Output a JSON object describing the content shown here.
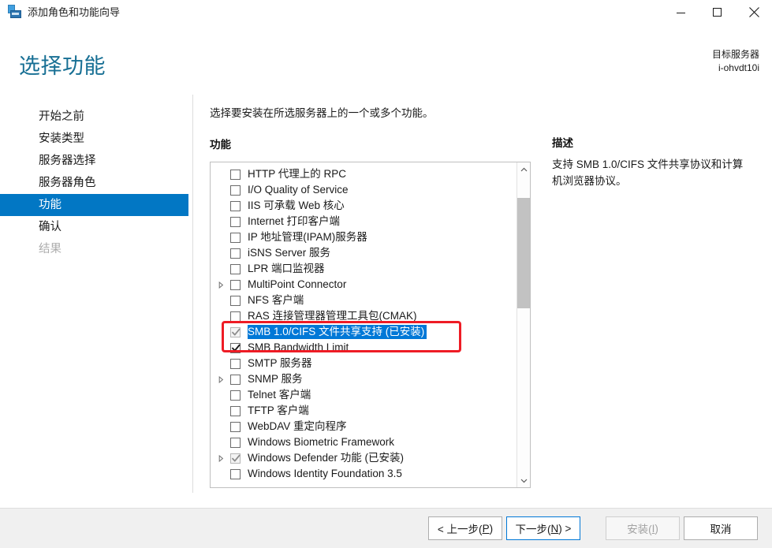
{
  "window": {
    "title": "添加角色和功能向导",
    "icon": "server-wizard-icon",
    "buttons": {
      "minimize": "minimize-icon",
      "maximize": "maximize-icon",
      "close": "close-icon"
    }
  },
  "header": {
    "page_title": "选择功能",
    "target_server_label": "目标服务器",
    "target_server_name": "i-ohvdt10i"
  },
  "sidebar": {
    "items": [
      {
        "label": "开始之前",
        "state": "normal"
      },
      {
        "label": "安装类型",
        "state": "normal"
      },
      {
        "label": "服务器选择",
        "state": "normal"
      },
      {
        "label": "服务器角色",
        "state": "normal"
      },
      {
        "label": "功能",
        "state": "selected"
      },
      {
        "label": "确认",
        "state": "normal"
      },
      {
        "label": "结果",
        "state": "disabled"
      }
    ]
  },
  "main": {
    "instruction": "选择要安装在所选服务器上的一个或多个功能。",
    "features_label": "功能",
    "features": [
      {
        "label": "HTTP 代理上的 RPC",
        "checked": false,
        "disabled": false,
        "expandable": false,
        "selected": false
      },
      {
        "label": "I/O Quality of Service",
        "checked": false,
        "disabled": false,
        "expandable": false,
        "selected": false
      },
      {
        "label": "IIS 可承载 Web 核心",
        "checked": false,
        "disabled": false,
        "expandable": false,
        "selected": false
      },
      {
        "label": "Internet 打印客户端",
        "checked": false,
        "disabled": false,
        "expandable": false,
        "selected": false
      },
      {
        "label": "IP 地址管理(IPAM)服务器",
        "checked": false,
        "disabled": false,
        "expandable": false,
        "selected": false
      },
      {
        "label": "iSNS Server 服务",
        "checked": false,
        "disabled": false,
        "expandable": false,
        "selected": false
      },
      {
        "label": "LPR 端口监视器",
        "checked": false,
        "disabled": false,
        "expandable": false,
        "selected": false
      },
      {
        "label": "MultiPoint Connector",
        "checked": false,
        "disabled": false,
        "expandable": true,
        "selected": false
      },
      {
        "label": "NFS 客户端",
        "checked": false,
        "disabled": false,
        "expandable": false,
        "selected": false
      },
      {
        "label": "RAS 连接管理器管理工具包(CMAK)",
        "checked": false,
        "disabled": false,
        "expandable": false,
        "selected": false
      },
      {
        "label": "SMB 1.0/CIFS 文件共享支持 (已安装)",
        "checked": true,
        "disabled": true,
        "expandable": false,
        "selected": true
      },
      {
        "label": "SMB Bandwidth Limit",
        "checked": true,
        "disabled": false,
        "expandable": false,
        "selected": false
      },
      {
        "label": "SMTP 服务器",
        "checked": false,
        "disabled": false,
        "expandable": false,
        "selected": false
      },
      {
        "label": "SNMP 服务",
        "checked": false,
        "disabled": false,
        "expandable": true,
        "selected": false
      },
      {
        "label": "Telnet 客户端",
        "checked": false,
        "disabled": false,
        "expandable": false,
        "selected": false
      },
      {
        "label": "TFTP 客户端",
        "checked": false,
        "disabled": false,
        "expandable": false,
        "selected": false
      },
      {
        "label": "WebDAV 重定向程序",
        "checked": false,
        "disabled": false,
        "expandable": false,
        "selected": false
      },
      {
        "label": "Windows Biometric Framework",
        "checked": false,
        "disabled": false,
        "expandable": false,
        "selected": false
      },
      {
        "label": "Windows Defender 功能 (已安装)",
        "checked": true,
        "disabled": true,
        "expandable": true,
        "selected": false
      },
      {
        "label": "Windows Identity Foundation 3.5",
        "checked": false,
        "disabled": false,
        "expandable": false,
        "selected": false
      }
    ]
  },
  "description": {
    "title": "描述",
    "body": "支持 SMB 1.0/CIFS 文件共享协议和计算机浏览器协议。"
  },
  "annotation": {
    "color": "#ee1c25",
    "shape": "rectangle-highlight"
  },
  "footer": {
    "previous": "< 上一步(P)",
    "next": "下一步(N) >",
    "install": "安装(I)",
    "cancel": "取消"
  },
  "colors": {
    "accent": "#0277c4",
    "title_blue": "#176f94",
    "selection": "#0078d7",
    "annotation_red": "#ee1c25"
  }
}
